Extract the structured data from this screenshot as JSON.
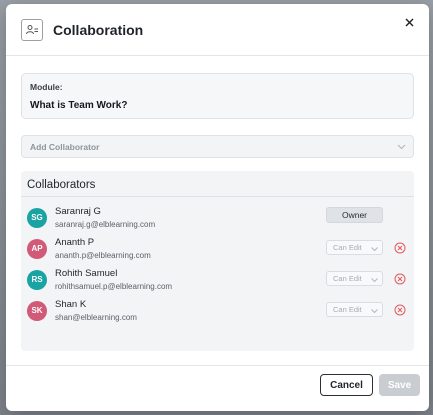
{
  "dialog": {
    "title": "Collaboration",
    "icon": "people-icon",
    "close_icon": "close-icon"
  },
  "module": {
    "label": "Module:",
    "value": "What is Team Work?"
  },
  "add_collaborator": {
    "placeholder": "Add Collaborator",
    "icon": "chevron-down-icon"
  },
  "collaborators": {
    "heading": "Collaborators",
    "items": [
      {
        "initials": "SG",
        "name": "Saranraj G",
        "email": "saranraj.g@elblearning.com",
        "avatar_color": "#1aa3a3",
        "role": "Owner",
        "removable": false
      },
      {
        "initials": "AP",
        "name": "Ananth P",
        "email": "ananth.p@elblearning.com",
        "avatar_color": "#d05a78",
        "role": "Can Edit",
        "removable": true
      },
      {
        "initials": "RS",
        "name": "Rohith Samuel",
        "email": "rohithsamuel.p@elblearning.com",
        "avatar_color": "#1aa3a3",
        "role": "Can Edit",
        "removable": true
      },
      {
        "initials": "SK",
        "name": "Shan K",
        "email": "shan@elblearning.com",
        "avatar_color": "#d05a78",
        "role": "Can Edit",
        "removable": true
      }
    ]
  },
  "footer": {
    "cancel_label": "Cancel",
    "save_label": "Save"
  },
  "colors": {
    "remove_icon": "#e05a5a",
    "save_disabled": "#c9ccd1"
  }
}
